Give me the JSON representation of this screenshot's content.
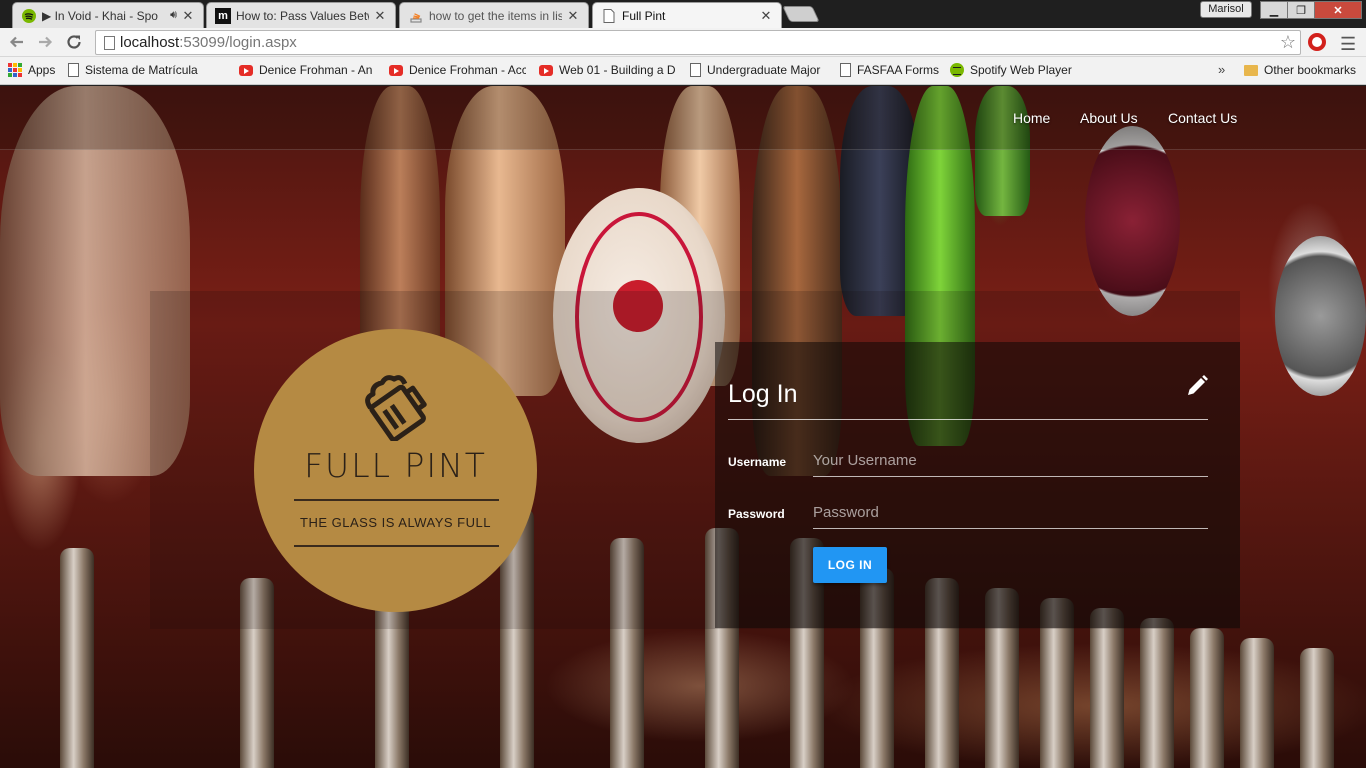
{
  "browser": {
    "tabs": [
      {
        "title": "▶ In Void - Khai - Spo",
        "favicon": "spotify-icon"
      },
      {
        "title": "How to: Pass Values Betw",
        "favicon": "m-logo-icon"
      },
      {
        "title": "how to get the items in lis",
        "favicon": "stackoverflow-icon"
      },
      {
        "title": "Full Pint",
        "favicon": "page-icon"
      }
    ],
    "profile_name": "Marisol",
    "url_host": "localhost",
    "url_rest": ":53099/login.aspx",
    "bookmarks": [
      {
        "label": "Apps",
        "icon": "apps-icon"
      },
      {
        "label": "Sistema de Matrícula",
        "icon": "page-icon"
      },
      {
        "label": "Denice Frohman - An",
        "icon": "youtube-icon"
      },
      {
        "label": "Denice Frohman - Acc",
        "icon": "youtube-icon"
      },
      {
        "label": "Web 01 - Building a D",
        "icon": "youtube-icon"
      },
      {
        "label": "Undergraduate Major",
        "icon": "page-icon"
      },
      {
        "label": "FASFAA Forms",
        "icon": "page-icon"
      },
      {
        "label": "Spotify Web Player",
        "icon": "spotify-icon"
      }
    ],
    "other_bookmarks": "Other bookmarks",
    "overflow_chevron": "»"
  },
  "site": {
    "nav": [
      {
        "label": "Home"
      },
      {
        "label": "About Us"
      },
      {
        "label": "Contact Us"
      }
    ],
    "logo": {
      "title": "FULL PINT",
      "tagline": "THE GLASS IS ALWAYS FULL",
      "icon": "beer-mug-icon",
      "color": "#b58a43"
    },
    "login": {
      "title": "Log In",
      "username_label": "Username",
      "username_placeholder": "Your Username",
      "password_label": "Password",
      "password_placeholder": "Password",
      "button": "LOG IN",
      "button_color": "#2196f3"
    }
  }
}
